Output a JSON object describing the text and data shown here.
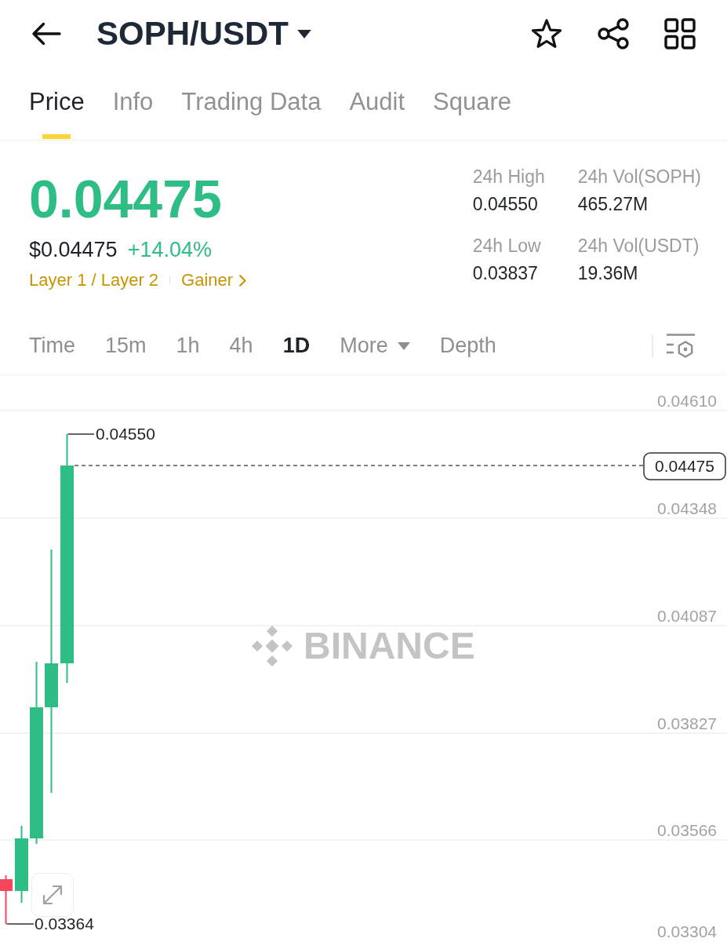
{
  "header": {
    "pair": "SOPH/USDT"
  },
  "tabs": [
    {
      "label": "Price",
      "selected": true
    },
    {
      "label": "Info",
      "selected": false
    },
    {
      "label": "Trading Data",
      "selected": false
    },
    {
      "label": "Audit",
      "selected": false
    },
    {
      "label": "Square",
      "selected": false
    }
  ],
  "price": {
    "last": "0.04475",
    "fiat": "$0.04475",
    "change": "+14.04%",
    "tags": [
      {
        "label": "Layer 1 / Layer 2",
        "kind": "plain"
      },
      {
        "label": "Gainer",
        "kind": "link"
      }
    ]
  },
  "stats": [
    {
      "label": "24h High",
      "value": "0.04550"
    },
    {
      "label": "24h Vol(SOPH)",
      "value": "465.27M"
    },
    {
      "label": "24h Low",
      "value": "0.03837"
    },
    {
      "label": "24h Vol(USDT)",
      "value": "19.36M"
    }
  ],
  "intervals": [
    {
      "label": "Time",
      "kind": "plain",
      "selected": false
    },
    {
      "label": "15m",
      "kind": "plain",
      "selected": false
    },
    {
      "label": "1h",
      "kind": "plain",
      "selected": false
    },
    {
      "label": "4h",
      "kind": "plain",
      "selected": false
    },
    {
      "label": "1D",
      "kind": "plain",
      "selected": true
    },
    {
      "label": "More",
      "kind": "dropdown",
      "selected": false
    },
    {
      "label": "Depth",
      "kind": "plain",
      "selected": false
    }
  ],
  "chart": {
    "watermark": "BINANCE",
    "price_axis": [
      "0.04610",
      "0.04348",
      "0.04087",
      "0.03827",
      "0.03566",
      "0.03304"
    ],
    "high_label": "0.04550",
    "low_label": "0.03364",
    "last_price": "0.04475",
    "candles": [
      {
        "color": "#f6465d"
      },
      {
        "color": "#2ebd85"
      },
      {
        "color": "#2ebd85"
      },
      {
        "color": "#2ebd85"
      },
      {
        "color": "#2ebd85"
      }
    ]
  }
}
